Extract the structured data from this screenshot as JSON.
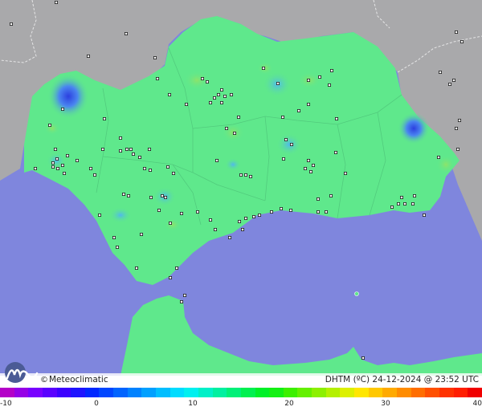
{
  "map": {
    "brand": "Meteoclimatic",
    "brand_symbol": "©",
    "title": "DHTM (ºC)  24-12-2024 @ 23:52 UTC"
  },
  "legend": {
    "min": -10,
    "max": 40,
    "ticks": [
      "-10",
      "0",
      "10",
      "20",
      "30",
      "40"
    ],
    "tick_values": [
      -10,
      0,
      10,
      20,
      30,
      40
    ],
    "colors": [
      "#b400c8",
      "#9600e6",
      "#7800ff",
      "#5a00ff",
      "#3c00ff",
      "#1e14ff",
      "#0028ff",
      "#0046ff",
      "#0064ff",
      "#0082ff",
      "#00a0ff",
      "#00beff",
      "#00dcff",
      "#00f0f0",
      "#00f0c8",
      "#00f0a0",
      "#00f078",
      "#00f050",
      "#00f028",
      "#14f014",
      "#3cf000",
      "#64f000",
      "#8cf000",
      "#b4f000",
      "#dcf000",
      "#ffe600",
      "#ffc800",
      "#ffaa00",
      "#ff8c00",
      "#ff6e00",
      "#ff5000",
      "#ff3200",
      "#ff1e00",
      "#f00000"
    ]
  },
  "colors": {
    "sea": "#7f86dd",
    "land_outside": "#a6a6a8",
    "land_region": "#5fe88c",
    "hot_spot_cold": "#3f6fe8"
  },
  "stations_icon": "station-marker-icon"
}
